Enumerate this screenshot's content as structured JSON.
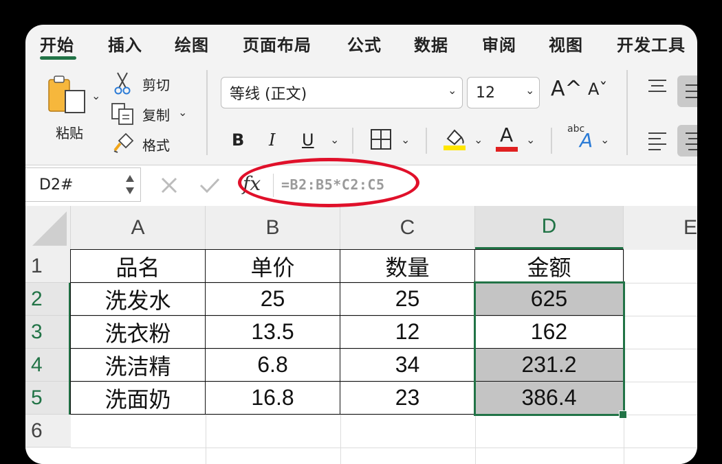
{
  "tabs": [
    "开始",
    "插入",
    "绘图",
    "页面布局",
    "公式",
    "数据",
    "审阅",
    "视图",
    "开发工具"
  ],
  "active_tab": "开始",
  "clipboard": {
    "paste_label": "粘贴",
    "cut_label": "剪切",
    "copy_label": "复制",
    "format_label": "格式"
  },
  "font": {
    "family": "等线 (正文)",
    "size": "12",
    "grow_label": "A^",
    "shrink_label": "Aˇ",
    "bold_label": "B",
    "italic_label": "I",
    "underline_label": "U",
    "font_color_letter": "A",
    "highlight_color": "#ffe600",
    "font_color": "#e02020",
    "text_effect_small": "abc"
  },
  "formula_bar": {
    "name_box": "D2#",
    "fx_label": "fx",
    "formula": "=B2:B5*C2:C5"
  },
  "sheet": {
    "columns": [
      "A",
      "B",
      "C",
      "D",
      "E"
    ],
    "rows": [
      "1",
      "2",
      "3",
      "4",
      "5",
      "6"
    ],
    "selected_column": "D",
    "accent": "#217346",
    "data": [
      [
        "品名",
        "单价",
        "数量",
        "金额"
      ],
      [
        "洗发水",
        "25",
        "25",
        "625"
      ],
      [
        "洗衣粉",
        "13.5",
        "12",
        "162"
      ],
      [
        "洗洁精",
        "6.8",
        "34",
        "231.2"
      ],
      [
        "洗面奶",
        "16.8",
        "23",
        "386.4"
      ]
    ]
  }
}
